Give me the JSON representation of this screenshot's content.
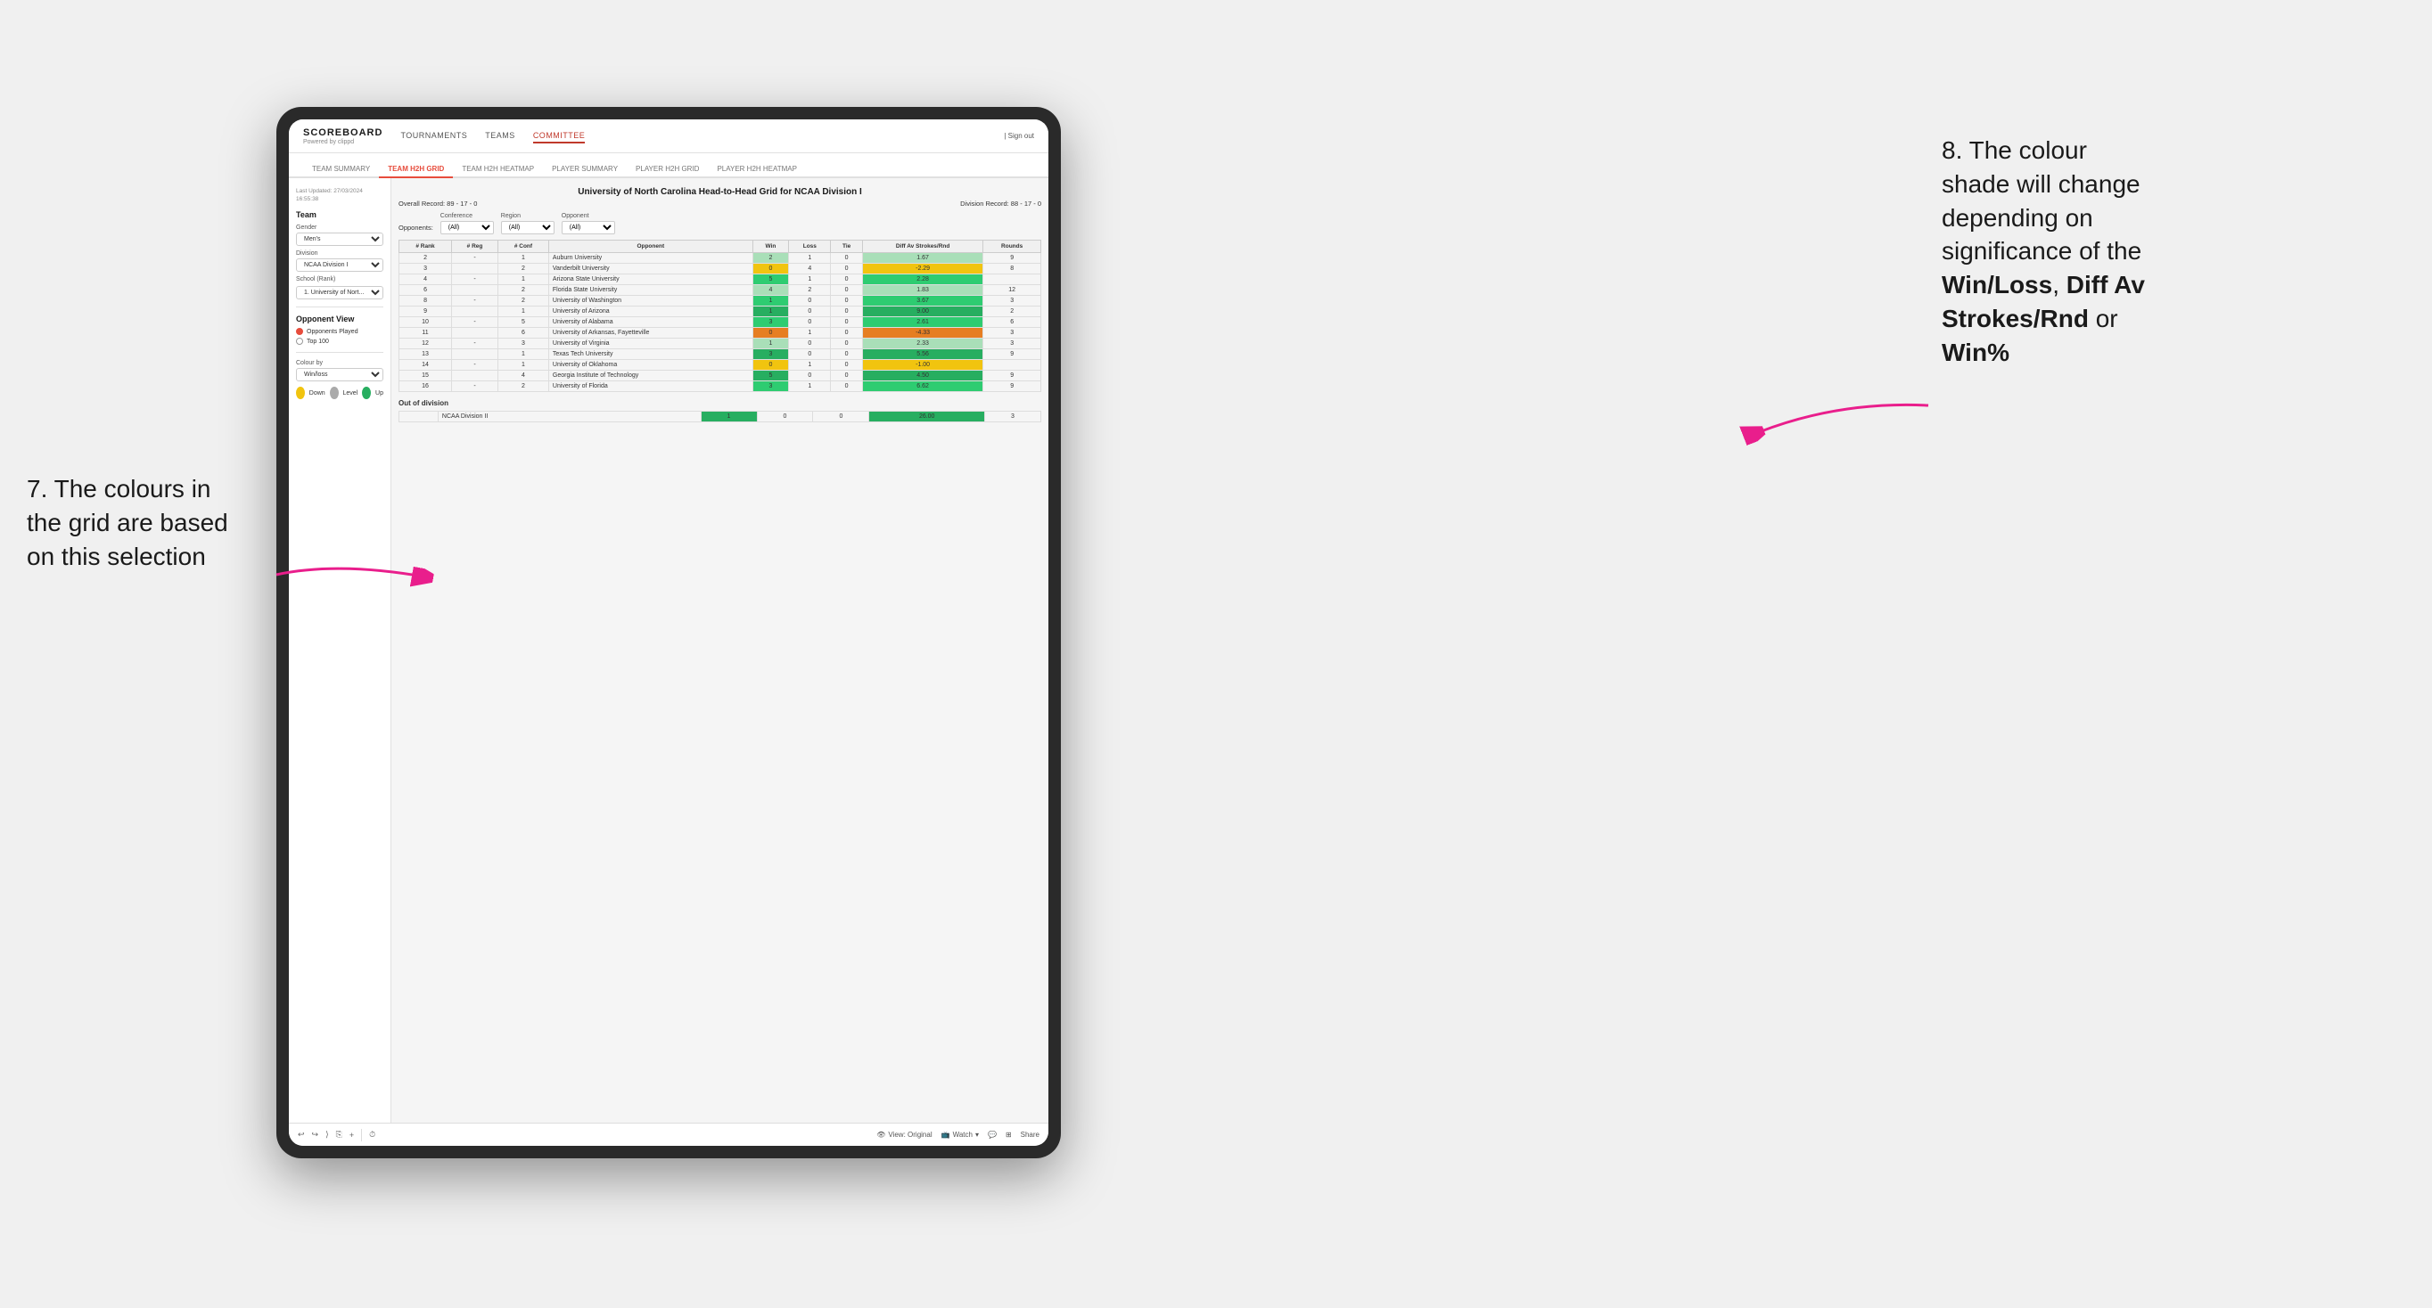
{
  "app": {
    "logo": "SCOREBOARD",
    "logo_sub": "Powered by clippd",
    "sign_out": "Sign out",
    "nav": [
      {
        "label": "TOURNAMENTS",
        "active": false
      },
      {
        "label": "TEAMS",
        "active": false
      },
      {
        "label": "COMMITTEE",
        "active": true
      }
    ],
    "sub_nav": [
      {
        "label": "TEAM SUMMARY",
        "active": false
      },
      {
        "label": "TEAM H2H GRID",
        "active": true
      },
      {
        "label": "TEAM H2H HEATMAP",
        "active": false
      },
      {
        "label": "PLAYER SUMMARY",
        "active": false
      },
      {
        "label": "PLAYER H2H GRID",
        "active": false
      },
      {
        "label": "PLAYER H2H HEATMAP",
        "active": false
      }
    ]
  },
  "sidebar": {
    "last_updated": "Last Updated: 27/03/2024\n16:55:38",
    "team_section": "Team",
    "gender_label": "Gender",
    "gender_value": "Men's",
    "division_label": "Division",
    "division_value": "NCAA Division I",
    "school_label": "School (Rank)",
    "school_value": "1. University of Nort...",
    "opponent_view_title": "Opponent View",
    "radio_options": [
      {
        "label": "Opponents Played",
        "selected": true
      },
      {
        "label": "Top 100",
        "selected": false
      }
    ],
    "colour_by_label": "Colour by",
    "colour_by_value": "Win/loss",
    "legend": [
      {
        "color": "#f1c40f",
        "label": "Down"
      },
      {
        "color": "#aaa",
        "label": "Level"
      },
      {
        "color": "#27ae60",
        "label": "Up"
      }
    ]
  },
  "grid": {
    "title": "University of North Carolina Head-to-Head Grid for NCAA Division I",
    "overall_record": "Overall Record: 89 - 17 - 0",
    "division_record": "Division Record: 88 - 17 - 0",
    "filter_row": {
      "opponents_label": "Opponents:",
      "conference_label": "Conference",
      "conference_value": "(All)",
      "region_label": "Region",
      "region_value": "(All)",
      "opponent_label": "Opponent",
      "opponent_value": "(All)"
    },
    "columns": [
      "# Rank",
      "# Reg",
      "# Conf",
      "Opponent",
      "Win",
      "Loss",
      "Tie",
      "Diff Av Strokes/Rnd",
      "Rounds"
    ],
    "rows": [
      {
        "rank": "2",
        "reg": "-",
        "conf": "1",
        "opponent": "Auburn University",
        "win": "2",
        "loss": "1",
        "tie": "0",
        "diff": "1.67",
        "rounds": "9",
        "win_color": "green-light",
        "diff_color": "green-light"
      },
      {
        "rank": "3",
        "reg": "",
        "conf": "2",
        "opponent": "Vanderbilt University",
        "win": "0",
        "loss": "4",
        "tie": "0",
        "diff": "-2.29",
        "rounds": "8",
        "win_color": "yellow",
        "diff_color": "yellow"
      },
      {
        "rank": "4",
        "reg": "-",
        "conf": "1",
        "opponent": "Arizona State University",
        "win": "5",
        "loss": "1",
        "tie": "0",
        "diff": "2.28",
        "rounds": "",
        "win_color": "green",
        "diff_color": "green"
      },
      {
        "rank": "6",
        "reg": "",
        "conf": "2",
        "opponent": "Florida State University",
        "win": "4",
        "loss": "2",
        "tie": "0",
        "diff": "1.83",
        "rounds": "12",
        "win_color": "green-light",
        "diff_color": "green-light"
      },
      {
        "rank": "8",
        "reg": "-",
        "conf": "2",
        "opponent": "University of Washington",
        "win": "1",
        "loss": "0",
        "tie": "0",
        "diff": "3.67",
        "rounds": "3",
        "win_color": "green",
        "diff_color": "green"
      },
      {
        "rank": "9",
        "reg": "",
        "conf": "1",
        "opponent": "University of Arizona",
        "win": "1",
        "loss": "0",
        "tie": "0",
        "diff": "9.00",
        "rounds": "2",
        "win_color": "green-dark",
        "diff_color": "green-dark"
      },
      {
        "rank": "10",
        "reg": "-",
        "conf": "5",
        "opponent": "University of Alabama",
        "win": "3",
        "loss": "0",
        "tie": "0",
        "diff": "2.61",
        "rounds": "6",
        "win_color": "green",
        "diff_color": "green"
      },
      {
        "rank": "11",
        "reg": "",
        "conf": "6",
        "opponent": "University of Arkansas, Fayetteville",
        "win": "0",
        "loss": "1",
        "tie": "0",
        "diff": "-4.33",
        "rounds": "3",
        "win_color": "orange",
        "diff_color": "orange"
      },
      {
        "rank": "12",
        "reg": "-",
        "conf": "3",
        "opponent": "University of Virginia",
        "win": "1",
        "loss": "0",
        "tie": "0",
        "diff": "2.33",
        "rounds": "3",
        "win_color": "green-light",
        "diff_color": "green-light"
      },
      {
        "rank": "13",
        "reg": "",
        "conf": "1",
        "opponent": "Texas Tech University",
        "win": "3",
        "loss": "0",
        "tie": "0",
        "diff": "5.56",
        "rounds": "9",
        "win_color": "green-dark",
        "diff_color": "green-dark"
      },
      {
        "rank": "14",
        "reg": "-",
        "conf": "1",
        "opponent": "University of Oklahoma",
        "win": "0",
        "loss": "1",
        "tie": "0",
        "diff": "-1.00",
        "rounds": "",
        "win_color": "yellow",
        "diff_color": "yellow"
      },
      {
        "rank": "15",
        "reg": "",
        "conf": "4",
        "opponent": "Georgia Institute of Technology",
        "win": "5",
        "loss": "0",
        "tie": "0",
        "diff": "4.50",
        "rounds": "9",
        "win_color": "green-dark",
        "diff_color": "green-dark"
      },
      {
        "rank": "16",
        "reg": "-",
        "conf": "2",
        "opponent": "University of Florida",
        "win": "3",
        "loss": "1",
        "tie": "0",
        "diff": "6.62",
        "rounds": "9",
        "win_color": "green",
        "diff_color": "green"
      }
    ],
    "out_of_division_title": "Out of division",
    "out_of_division_rows": [
      {
        "label": "NCAA Division II",
        "win": "1",
        "loss": "0",
        "tie": "0",
        "diff": "26.00",
        "rounds": "3",
        "diff_color": "green-dark"
      }
    ]
  },
  "annotations": {
    "left": "7. The colours in\nthe grid are based\non this selection",
    "right_prefix": "8. The colour\nshade will change\ndepending on\nsignificance of the\n",
    "right_bold1": "Win/Loss",
    "right_sep1": ", ",
    "right_bold2": "Diff Av\nStrokes/Rnd",
    "right_sep2": " or\n",
    "right_bold3": "Win%"
  },
  "toolbar": {
    "view_label": "View: Original",
    "watch_label": "Watch",
    "share_label": "Share"
  }
}
